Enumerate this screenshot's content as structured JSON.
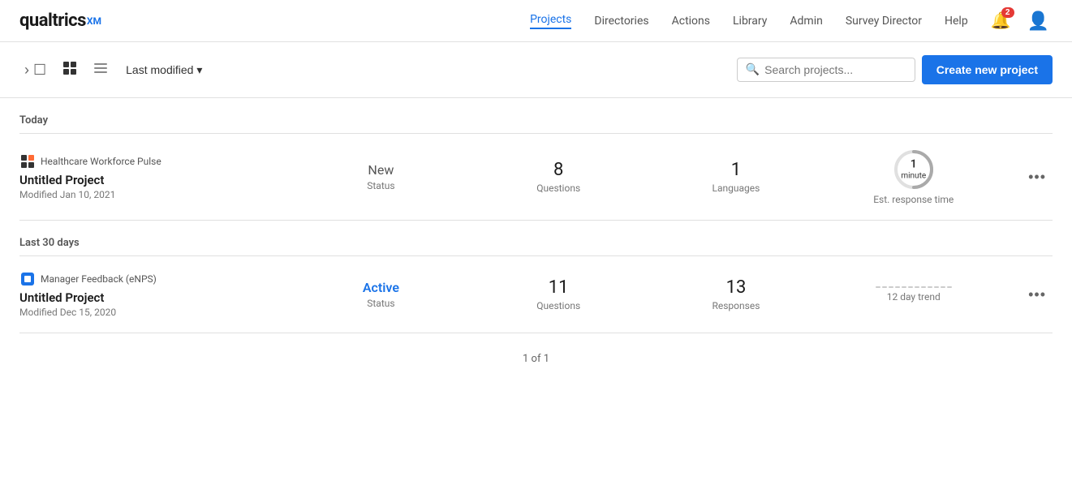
{
  "navbar": {
    "logo": "qualtrics",
    "logo_xm": "XM",
    "nav_items": [
      {
        "label": "Projects",
        "active": true
      },
      {
        "label": "Directories",
        "active": false
      },
      {
        "label": "Actions",
        "active": false
      },
      {
        "label": "Library",
        "active": false
      },
      {
        "label": "Admin",
        "active": false
      },
      {
        "label": "Survey Director",
        "active": false
      },
      {
        "label": "Help",
        "active": false
      }
    ],
    "notification_count": "2"
  },
  "toolbar": {
    "sort_label": "Last modified",
    "search_placeholder": "Search projects...",
    "create_label": "Create new project"
  },
  "sections": [
    {
      "label": "Today",
      "projects": [
        {
          "type_label": "Healthcare Workforce Pulse",
          "type_icon": "4square",
          "name": "Untitled Project",
          "modified": "Modified Jan 10, 2021",
          "stats": [
            {
              "value": "New",
              "label": "Status",
              "type": "new-status"
            },
            {
              "value": "8",
              "label": "Questions",
              "type": "number"
            },
            {
              "value": "1",
              "label": "Languages",
              "type": "number"
            },
            {
              "value": "",
              "label": "Est. response time",
              "type": "circle",
              "circle_num": "1",
              "circle_sub": "minute"
            }
          ]
        }
      ]
    },
    {
      "label": "Last 30 days",
      "projects": [
        {
          "type_label": "Manager Feedback (eNPS)",
          "type_icon": "enps",
          "name": "Untitled Project",
          "modified": "Modified Dec 15, 2020",
          "stats": [
            {
              "value": "Active",
              "label": "Status",
              "type": "active-status"
            },
            {
              "value": "11",
              "label": "Questions",
              "type": "number"
            },
            {
              "value": "13",
              "label": "Responses",
              "type": "number"
            },
            {
              "value": "",
              "label": "12 day trend",
              "type": "trend"
            }
          ]
        }
      ]
    }
  ],
  "pagination": {
    "label": "1 of 1"
  }
}
